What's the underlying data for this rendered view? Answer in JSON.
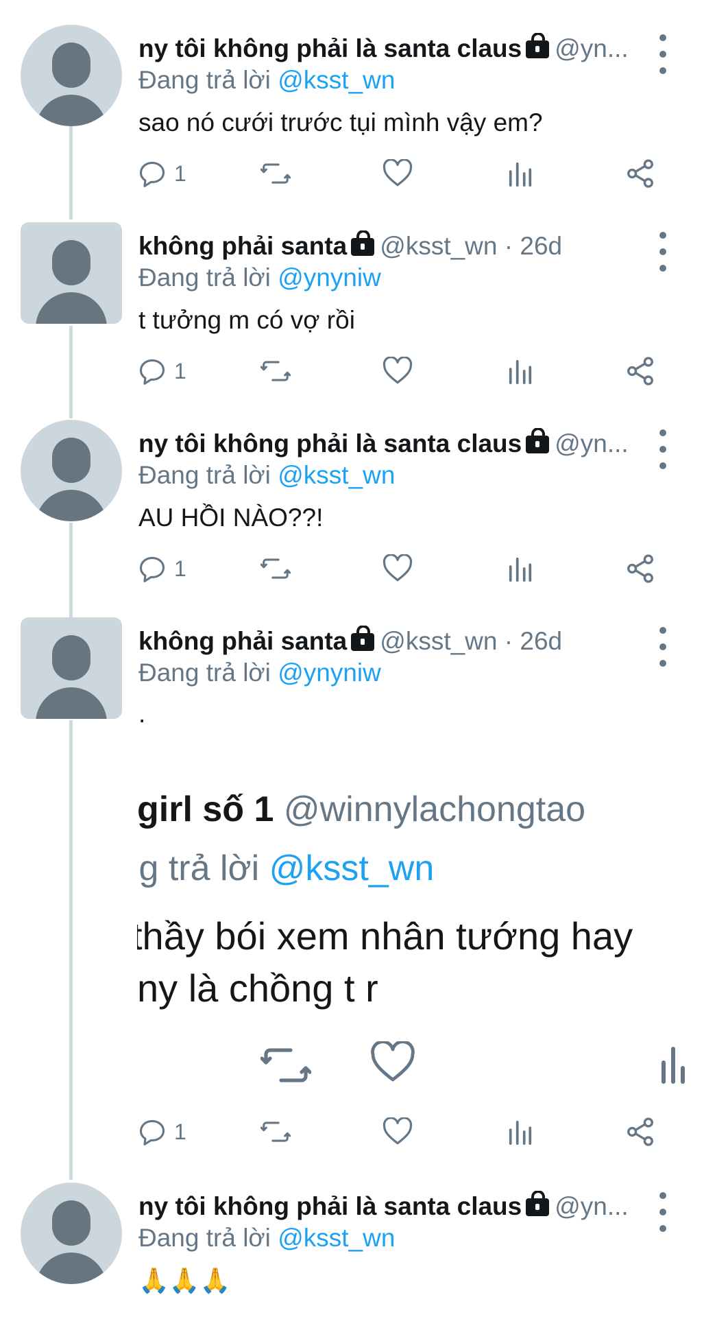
{
  "colors": {
    "accent": "#1da1f2",
    "secondary_text": "#657786",
    "primary_text": "#14171a",
    "thread_line": "#cfd9de"
  },
  "tweets": [
    {
      "name": "ny tôi không phải là santa claus",
      "handle": "@yn...",
      "reply_prefix": "Đang trả lời ",
      "reply_to": "@ksst_wn",
      "text": "sao nó cưới trước tụi mình vậy em?",
      "reply_count": "1"
    },
    {
      "name": "không phải santa",
      "handle": "@ksst_wn · 26d",
      "reply_prefix": "Đang trả lời ",
      "reply_to": "@ynyniw",
      "text": "t tưởng m có vợ rồi",
      "reply_count": "1"
    },
    {
      "name": "ny tôi không phải là santa claus",
      "handle": "@yn...",
      "reply_prefix": "Đang trả lời ",
      "reply_to": "@ksst_wn",
      "text": "AU HỒI NÀO??!",
      "reply_count": "1"
    },
    {
      "name": "không phải santa",
      "handle": "@ksst_wn · 26d",
      "reply_prefix": "Đang trả lời ",
      "reply_to": "@ynyniw",
      "text": ".",
      "reply_count": "1",
      "embedded_screenshot": {
        "name": "girl số 1",
        "handle": "@winnylachongtao",
        "reply_prefix": "ıg trả lời ",
        "reply_to": "@ksst_wn",
        "text_line1": "thầy bói xem nhân tướng hay",
        "text_line2": "ny là chồng t r"
      }
    },
    {
      "name": "ny tôi không phải là santa claus",
      "handle": "@yn...",
      "reply_prefix": "Đang trả lời ",
      "reply_to": "@ksst_wn",
      "text": "🙏🙏🙏"
    }
  ],
  "icons": [
    "reply-icon",
    "retweet-icon",
    "like-icon",
    "analytics-icon",
    "share-icon",
    "more-icon",
    "lock-icon"
  ]
}
